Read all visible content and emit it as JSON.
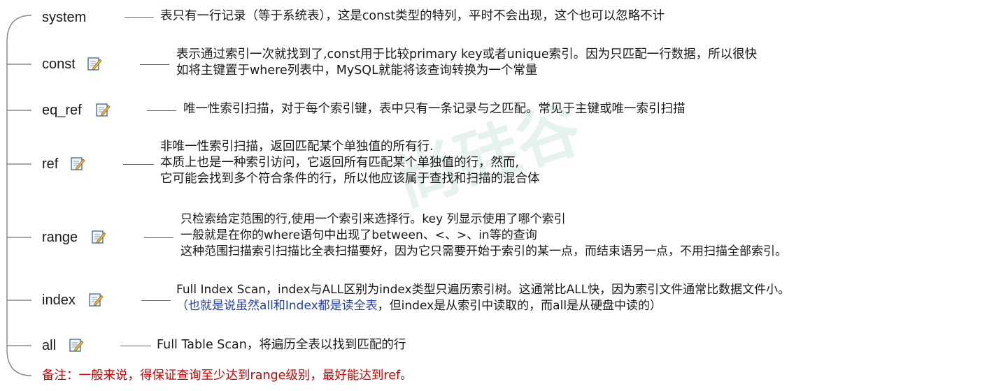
{
  "nodes": [
    {
      "label": "system",
      "has_icon": false,
      "lines": [
        "表只有一行记录（等于系统表），这是const类型的特列，平时不会出现，这个也可以忽略不计"
      ]
    },
    {
      "label": "const",
      "has_icon": true,
      "lines": [
        "表示通过索引一次就找到了,const用于比较primary key或者unique索引。因为只匹配一行数据，所以很快",
        "如将主键置于where列表中，MySQL就能将该查询转换为一个常量"
      ]
    },
    {
      "label": "eq_ref",
      "has_icon": true,
      "lines": [
        "唯一性索引扫描，对于每个索引键，表中只有一条记录与之匹配。常见于主键或唯一索引扫描"
      ]
    },
    {
      "label": "ref",
      "has_icon": true,
      "lines": [
        "非唯一性索引扫描，返回匹配某个单独值的所有行.",
        "本质上也是一种索引访问，它返回所有匹配某个单独值的行，然而,",
        "它可能会找到多个符合条件的行，所以他应该属于查找和扫描的混合体"
      ]
    },
    {
      "label": "range",
      "has_icon": true,
      "lines": [
        "只检索给定范围的行,使用一个索引来选择行。key 列显示使用了哪个索引",
        "一般就是在你的where语句中出现了between、<、>、in等的查询",
        "这种范围扫描索引扫描比全表扫描要好，因为它只需要开始于索引的某一点，而结束语另一点，不用扫描全部索引。"
      ]
    },
    {
      "label": "index",
      "has_icon": true,
      "lines": [
        "Full Index Scan，index与ALL区别为index类型只遍历索引树。这通常比ALL快，因为索引文件通常比数据文件小。"
      ],
      "line2_blue": "（也就是说虽然all和Index都是读全表",
      "line2_rest": "，但index是从索引中读取的，而all是从硬盘中读的）"
    },
    {
      "label": "all",
      "has_icon": true,
      "lines": [
        "Full Table Scan，将遍历全表以找到匹配的行"
      ]
    }
  ],
  "note": "备注：一般来说，得保证查询至少达到range级别，最好能达到ref。",
  "colors": {
    "blue_text": "#1f3fc0",
    "red_text": "#d40000",
    "line": "#8a8a8a"
  }
}
